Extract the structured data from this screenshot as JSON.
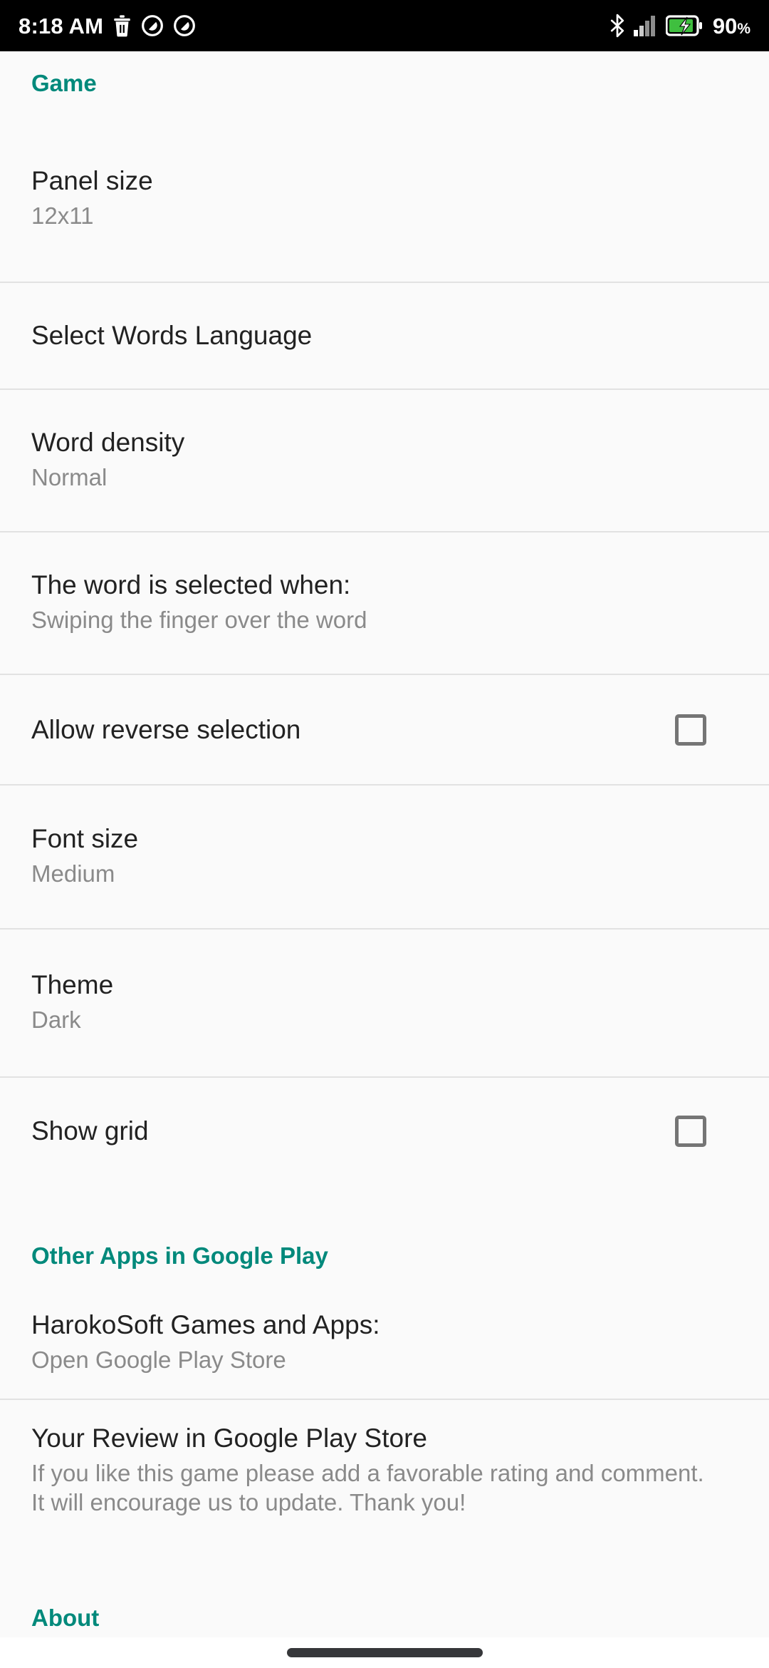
{
  "status_bar": {
    "time": "8:18 AM",
    "battery_percent": "90",
    "percent_symbol": "%",
    "left_icons": [
      "trash-icon",
      "do-not-disturb-icon",
      "do-not-disturb-icon"
    ],
    "right_icons": [
      "bluetooth-icon",
      "signal-bars-icon",
      "battery-charging-icon"
    ]
  },
  "accent_color": "#00897b",
  "sections": {
    "game": {
      "header": "Game"
    },
    "other_apps": {
      "header": "Other Apps in Google Play"
    },
    "about": {
      "header": "About"
    }
  },
  "preferences": {
    "panel_size": {
      "title": "Panel size",
      "summary": "12x11"
    },
    "select_words_language": {
      "title": "Select Words Language",
      "summary": ""
    },
    "word_density": {
      "title": "Word density",
      "summary": "Normal"
    },
    "word_selected_when": {
      "title": "The word is selected when:",
      "summary": "Swiping the finger over the word"
    },
    "allow_reverse_selection": {
      "title": "Allow reverse selection",
      "checked": false
    },
    "font_size": {
      "title": "Font size",
      "summary": "Medium"
    },
    "theme": {
      "title": "Theme",
      "summary": "Dark"
    },
    "show_grid": {
      "title": "Show grid",
      "checked": false
    },
    "harokosoft_games": {
      "title": "HarokoSoft Games and Apps:",
      "summary": "Open Google Play Store"
    },
    "your_review": {
      "title": "Your Review in Google Play Store",
      "summary": "If you like this game please add a favorable rating and comment. It will encourage us to update. Thank you!"
    }
  }
}
